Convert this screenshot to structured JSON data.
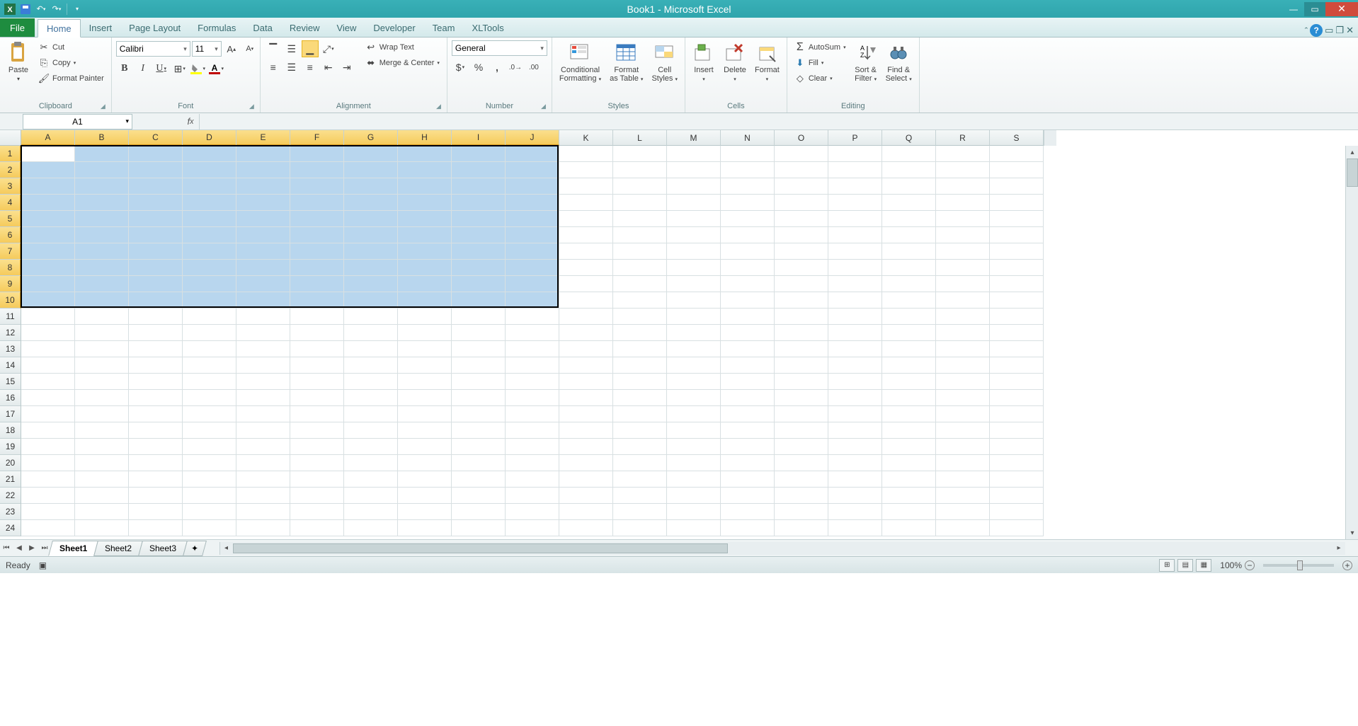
{
  "title": "Book1 - Microsoft Excel",
  "tabs": {
    "file": "File",
    "home": "Home",
    "insert": "Insert",
    "page": "Page Layout",
    "formulas": "Formulas",
    "data": "Data",
    "review": "Review",
    "view": "View",
    "developer": "Developer",
    "team": "Team",
    "xltools": "XLTools"
  },
  "clipboard": {
    "paste": "Paste",
    "cut": "Cut",
    "copy": "Copy",
    "fp": "Format Painter",
    "label": "Clipboard"
  },
  "font": {
    "name": "Calibri",
    "size": "11",
    "label": "Font"
  },
  "alignment": {
    "wrap": "Wrap Text",
    "merge": "Merge & Center",
    "label": "Alignment"
  },
  "number": {
    "format": "General",
    "label": "Number"
  },
  "styles": {
    "cond": "Conditional\nFormatting",
    "fat": "Format\nas Table",
    "cell": "Cell\nStyles",
    "label": "Styles"
  },
  "cells": {
    "insert": "Insert",
    "delete": "Delete",
    "format": "Format",
    "label": "Cells"
  },
  "editing": {
    "sum": "AutoSum",
    "fill": "Fill",
    "clear": "Clear",
    "sort": "Sort &\nFilter",
    "find": "Find &\nSelect",
    "label": "Editing"
  },
  "namebox": "A1",
  "cols": [
    "A",
    "B",
    "C",
    "D",
    "E",
    "F",
    "G",
    "H",
    "I",
    "J",
    "K",
    "L",
    "M",
    "N",
    "O",
    "P",
    "Q",
    "R",
    "S"
  ],
  "rows": [
    1,
    2,
    3,
    4,
    5,
    6,
    7,
    8,
    9,
    10,
    11,
    12,
    13,
    14,
    15,
    16,
    17,
    18,
    19,
    20,
    21,
    22,
    23,
    24
  ],
  "selCols": 10,
  "selRows": 10,
  "sheets": {
    "s1": "Sheet1",
    "s2": "Sheet2",
    "s3": "Sheet3"
  },
  "status": "Ready",
  "zoom": "100%"
}
